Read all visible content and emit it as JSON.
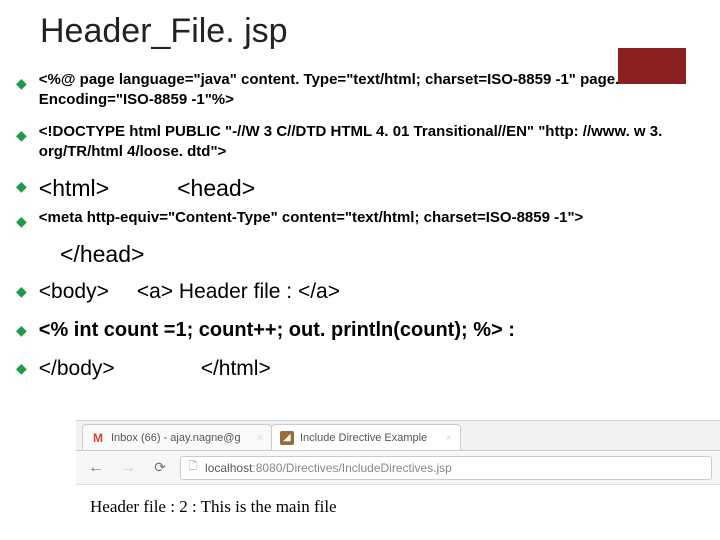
{
  "title": "Header_File. jsp",
  "bullets": {
    "b1": "<%@ page language=\"java\" content. Type=\"text/html; charset=ISO-8859 -1\" page. Encoding=\"ISO-8859 -1\"%>",
    "b2": "<!DOCTYPE html PUBLIC \"-//W 3 C//DTD HTML 4. 01 Transitional//EN\" \"http: //www. w 3. org/TR/html 4/loose. dtd\">",
    "b3a": "<html>",
    "b3b": "<head>",
    "b4": "<meta http-equiv=\"Content-Type\" content=\"text/html; charset=ISO-8859 -1\">",
    "b5": "</head>",
    "b6a": "<body>",
    "b6b": "<a>    Header file : </a>",
    "b7": "<% int count =1; count++;   out. println(count); %> :",
    "b8a": "</body>",
    "b8b": "</html>"
  },
  "browser": {
    "tabs": [
      {
        "label": "Inbox (66) - ajay.nagne@g"
      },
      {
        "label": "Include Directive Example"
      }
    ],
    "address_host": "localhost",
    "address_path": ":8080/Directives/IncludeDirectives.jsp",
    "page_text": "Header file : 2 : This is the main file"
  }
}
